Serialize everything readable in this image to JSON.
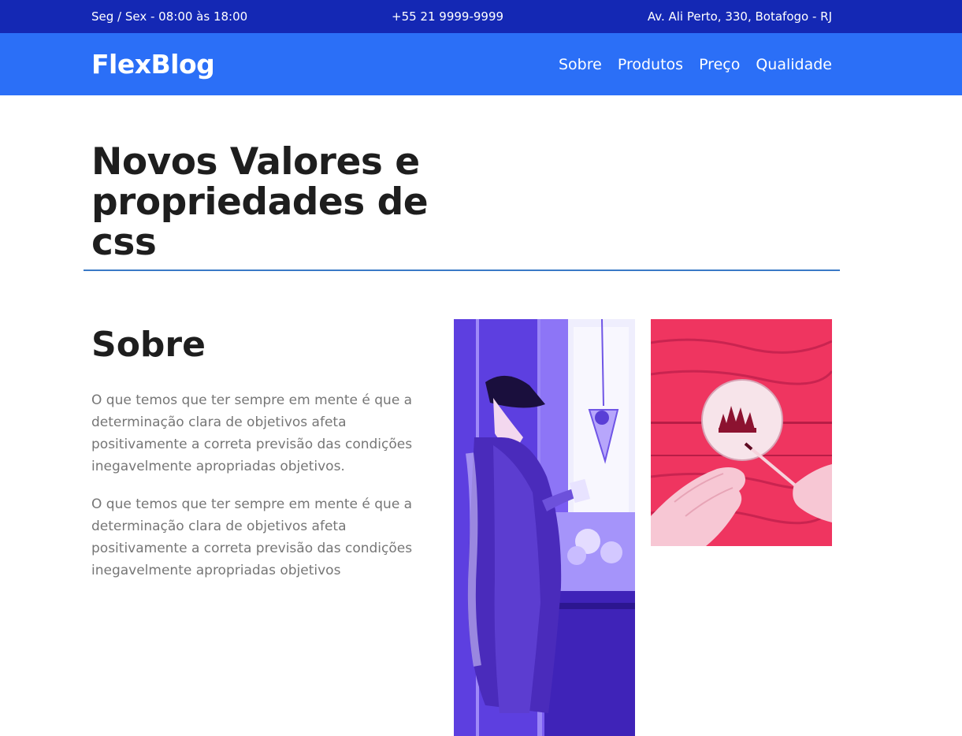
{
  "topbar": {
    "hours": "Seg / Sex - 08:00 às 18:00",
    "phone": "+55 21 9999-9999",
    "address": "Av. Ali Perto, 330, Botafogo - RJ"
  },
  "header": {
    "logo": "FlexBlog",
    "nav": [
      "Sobre",
      "Produtos",
      "Preço",
      "Qualidade"
    ]
  },
  "hero": {
    "title": "Novos Valores e propriedades de css"
  },
  "about": {
    "title": "Sobre",
    "paragraphs": [
      "O que temos que ter sempre em mente é que a determinação clara de objetivos afeta positivamente a correta previsão das condições inegavelmente apropriadas objetivos.",
      "O que temos que ter sempre em mente é que a determinação clara de objetivos afeta positivamente a correta previsão das condições inegavelmente apropriadas objetivos"
    ]
  },
  "colors": {
    "topbar": "#1428b4",
    "navbar": "#2b6ff7",
    "divider": "#3a79c6",
    "photo_purple": "#6a4cf0",
    "photo_pink": "#f23a63"
  }
}
